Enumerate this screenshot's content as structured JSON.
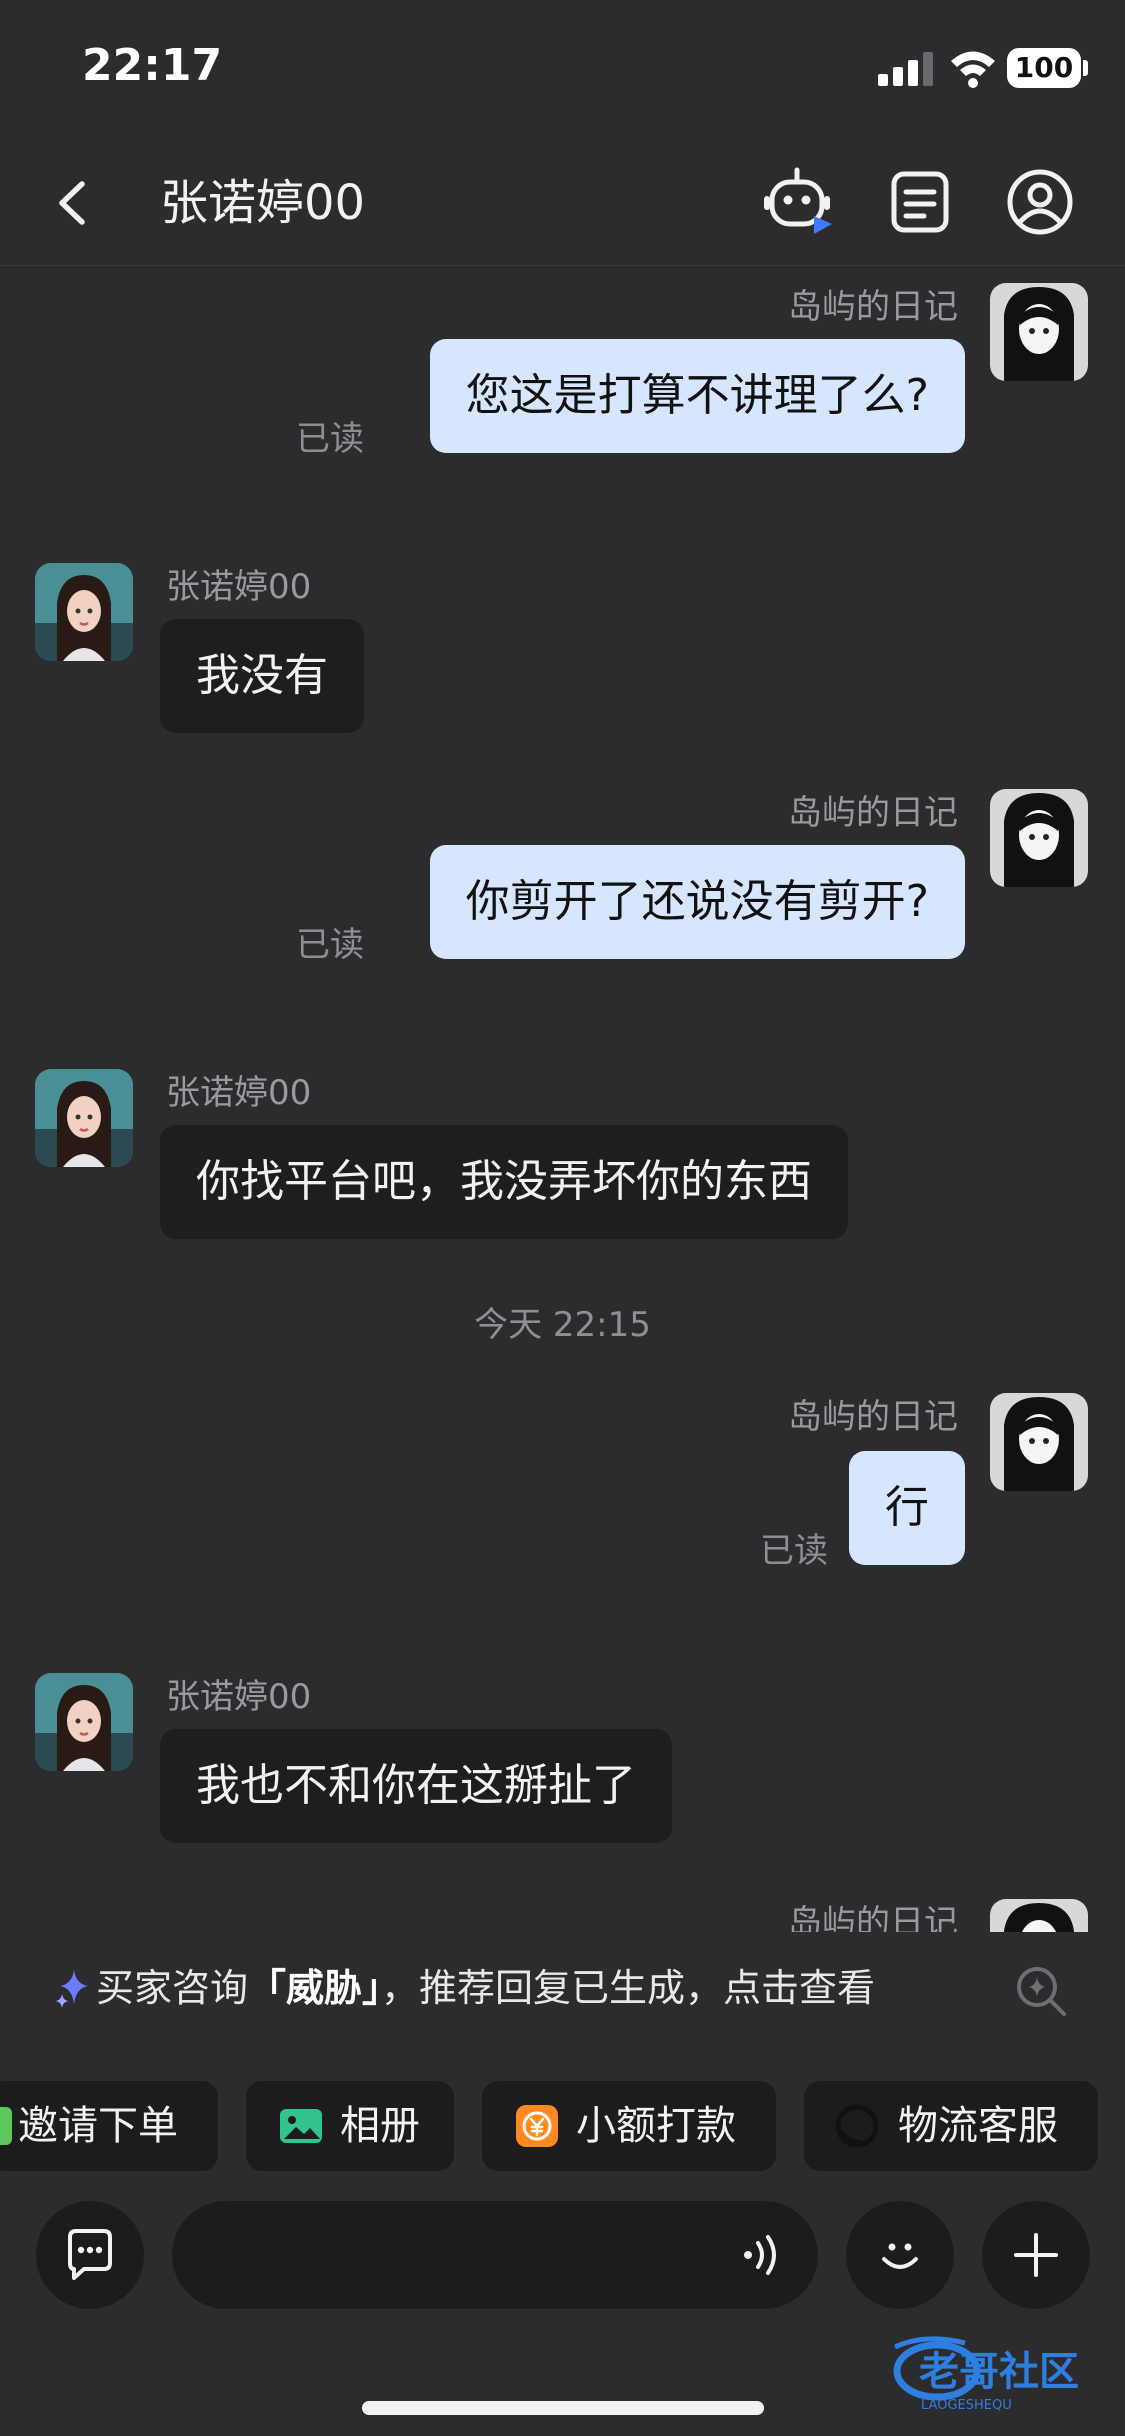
{
  "status_bar": {
    "time": "22:17",
    "battery": "100"
  },
  "nav": {
    "title": "张诺婷00"
  },
  "messages": [
    {
      "sender": "岛屿的日记",
      "text": "您这是打算不讲理了么?",
      "read": "已读"
    },
    {
      "sender": "张诺婷00",
      "text": "我没有"
    },
    {
      "sender": "岛屿的日记",
      "text": "你剪开了还说没有剪开?",
      "read": "已读"
    },
    {
      "sender": "张诺婷00",
      "text": "你找平台吧，我没弄坏你的东西"
    },
    {
      "timestamp": "今天 22:15"
    },
    {
      "sender": "岛屿的日记",
      "text": "行",
      "read": "已读"
    },
    {
      "sender": "张诺婷00",
      "text": "我也不和你在这掰扯了"
    },
    {
      "sender": "岛屿的日记"
    }
  ],
  "suggestion": {
    "prefix": "买家咨询",
    "keyword": "「威胁」",
    "suffix": "，推荐回复已生成，点击查看"
  },
  "quick_actions": [
    {
      "label": "邀请下单",
      "icon": "invite-order-icon"
    },
    {
      "label": "相册",
      "icon": "photo-album-icon",
      "color": "#34c38f"
    },
    {
      "label": "小额打款",
      "icon": "small-payment-icon",
      "color": "#ff8a1f"
    },
    {
      "label": "物流客服",
      "icon": "logistics-service-icon"
    }
  ],
  "input": {
    "placeholder": ""
  },
  "watermark": {
    "text": "老哥社区",
    "subtext": "LAOGESHEQU"
  },
  "colors": {
    "background": "#2c2c2e",
    "my_bubble": "#d7e6ff",
    "their_bubble": "#1e1e20",
    "accent": "#3d7bff"
  }
}
